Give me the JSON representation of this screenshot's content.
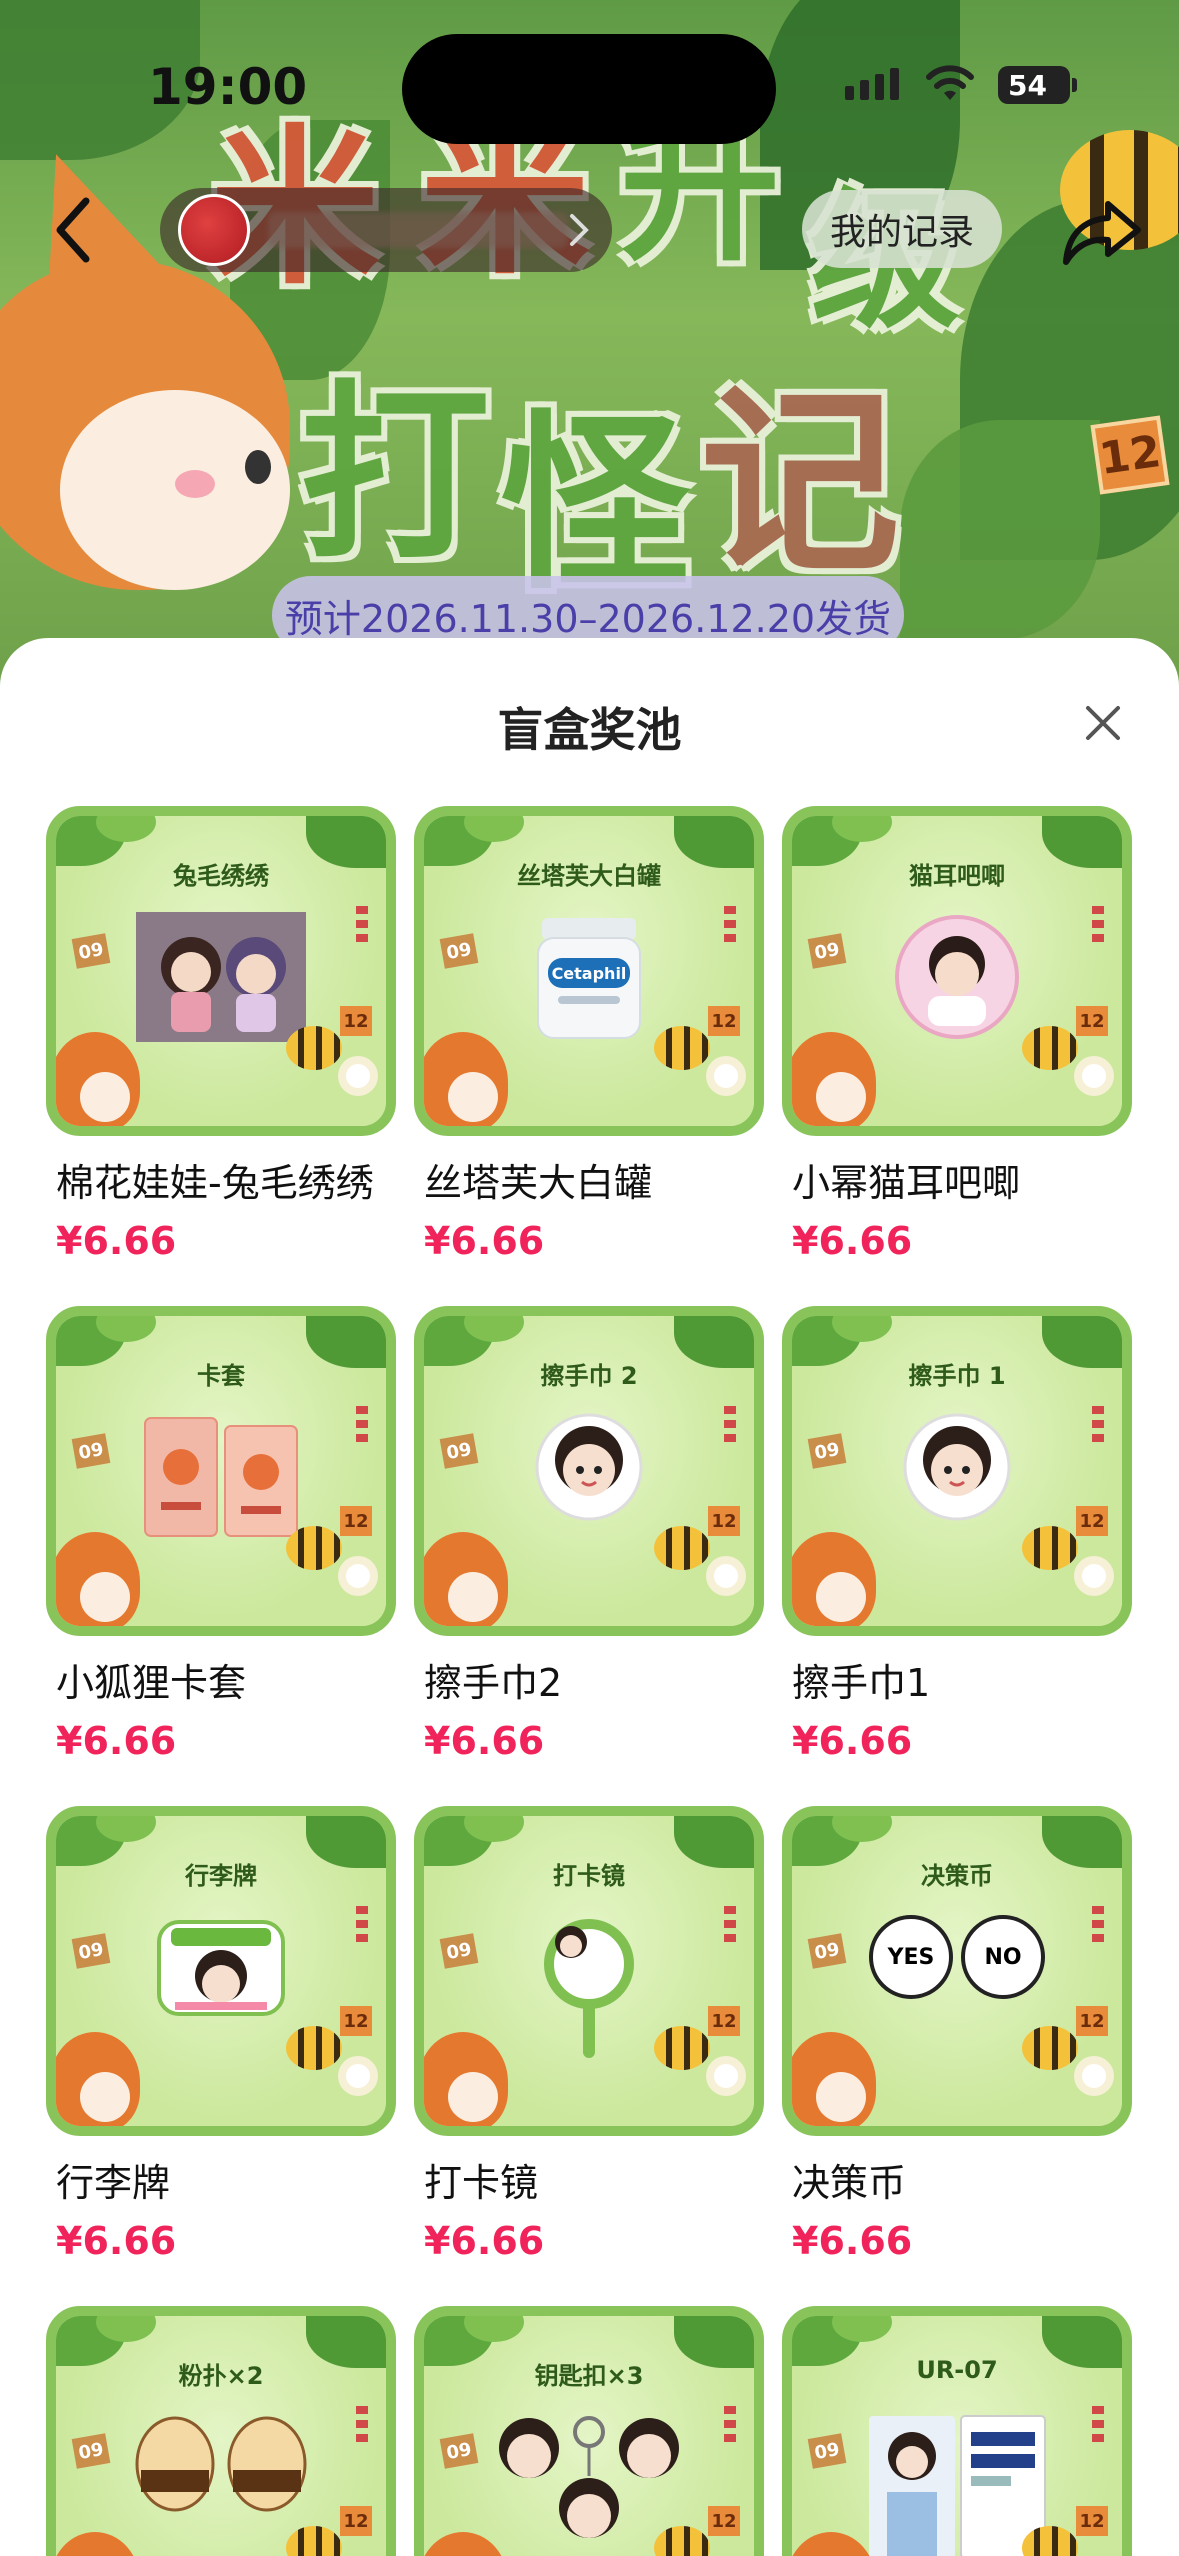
{
  "status_bar": {
    "time": "19:00",
    "battery": "54"
  },
  "header": {
    "my_records": "我的记录"
  },
  "hero": {
    "title_line1": [
      "米",
      "米",
      "升",
      "级"
    ],
    "title_line2": [
      "打",
      "怪",
      "记"
    ],
    "ship_notice": "预计2026.11.30–2026.12.20发货"
  },
  "sheet": {
    "title": "盲盒奖池"
  },
  "items": [
    {
      "label": "兔毛绣绣",
      "name": "棉花娃娃-兔毛绣绣",
      "price": "¥6.66",
      "product": "plush"
    },
    {
      "label": "丝塔芙大白罐",
      "name": "丝塔芙大白罐",
      "price": "¥6.66",
      "product": "jar"
    },
    {
      "label": "猫耳吧唧",
      "name": "小幂猫耳吧唧",
      "price": "¥6.66",
      "product": "badge"
    },
    {
      "label": "卡套",
      "name": "小狐狸卡套",
      "price": "¥6.66",
      "product": "cardholder"
    },
    {
      "label": "擦手巾 2",
      "name": "擦手巾2",
      "price": "¥6.66",
      "product": "towel"
    },
    {
      "label": "擦手巾 1",
      "name": "擦手巾1",
      "price": "¥6.66",
      "product": "towel"
    },
    {
      "label": "行李牌",
      "name": "行李牌",
      "price": "¥6.66",
      "product": "tag"
    },
    {
      "label": "打卡镜",
      "name": "打卡镜",
      "price": "¥6.66",
      "product": "mirror"
    },
    {
      "label": "决策币",
      "name": "决策币",
      "price": "¥6.66",
      "product": "coins"
    },
    {
      "label": "粉扑×2",
      "name": "",
      "price": "",
      "product": "puffs"
    },
    {
      "label": "钥匙扣×3",
      "name": "",
      "price": "",
      "product": "keychain"
    },
    {
      "label": "UR-07",
      "name": "",
      "price": "",
      "product": "photo"
    }
  ],
  "colors": {
    "price": "#f0245a",
    "card_border": "#88c45a"
  }
}
